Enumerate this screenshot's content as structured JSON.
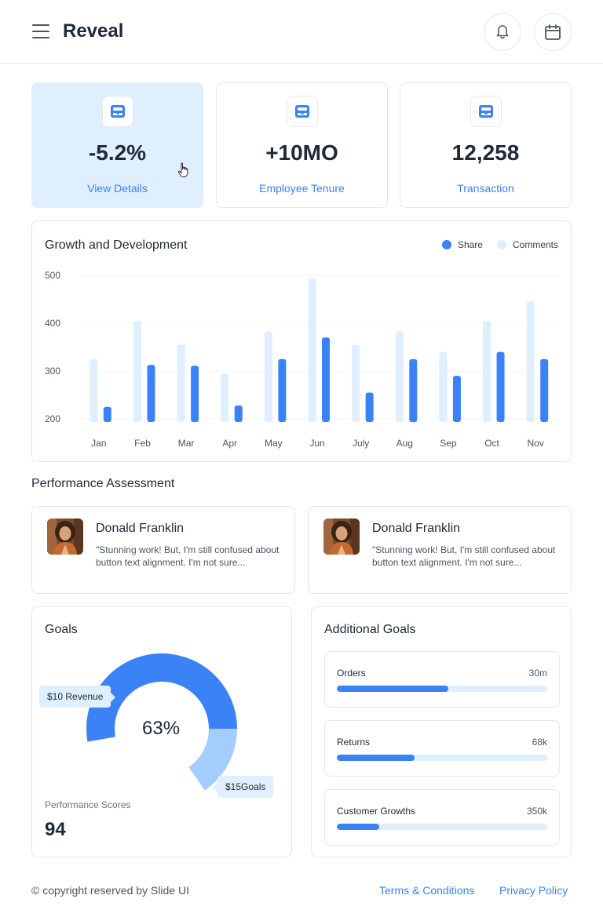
{
  "header": {
    "app_title": "Reveal"
  },
  "stats": [
    {
      "value": "-5.2%",
      "link": "View Details",
      "active": true
    },
    {
      "value": "+10MO",
      "link": "Employee Tenure",
      "active": false
    },
    {
      "value": "12,258",
      "link": "Transaction",
      "active": false
    }
  ],
  "chart": {
    "title": "Growth and Development"
  },
  "chart_data": {
    "type": "bar",
    "categories": [
      "Jan",
      "Feb",
      "Mar",
      "Apr",
      "May",
      "Jun",
      "July",
      "Aug",
      "Sep",
      "Oct",
      "Nov"
    ],
    "series": [
      {
        "name": "Comments",
        "color": "#e0effd",
        "values": [
          325,
          405,
          355,
          295,
          383,
          493,
          355,
          383,
          340,
          405,
          445
        ]
      },
      {
        "name": "Share",
        "color": "#3b82f6",
        "values": [
          225,
          313,
          311,
          228,
          325,
          370,
          255,
          325,
          290,
          340,
          325
        ]
      }
    ],
    "legend_order": [
      "Share",
      "Comments"
    ],
    "yticks": [
      500,
      400,
      300,
      200
    ],
    "ylim": [
      200,
      500
    ],
    "legend_position": "top-right",
    "grid": true
  },
  "performance": {
    "title": "Performance Assessment",
    "reviews": [
      {
        "name": "Donald Franklin",
        "text": "\"Stunning work! But, I'm still confused about button text alignment. I'm not sure..."
      },
      {
        "name": "Donald Franklin",
        "text": "\"Stunning work! But, I'm still confused about button text alignment. I'm not sure..."
      }
    ]
  },
  "goals": {
    "title": "Goals",
    "center_label": "63%",
    "progress_fraction": 0.63,
    "tooltip_revenue": "$10 Revenue",
    "tooltip_goals": "$15Goals",
    "perf_label": "Performance Scores",
    "perf_value": "94"
  },
  "additional_goals": {
    "title": "Additional Goals",
    "items": [
      {
        "name": "Orders",
        "value": "30m",
        "fraction": 0.53
      },
      {
        "name": "Returns",
        "value": "68k",
        "fraction": 0.37
      },
      {
        "name": "Customer Growths",
        "value": "350k",
        "fraction": 0.2
      }
    ]
  },
  "footer": {
    "copyright": "© copyright reserved by Slide UI",
    "terms": "Terms & Conditions",
    "privacy": "Privacy Policy"
  },
  "colors": {
    "accent": "#3b82f6",
    "accent_light": "#e0effd",
    "donut_light": "#a3cdfd"
  }
}
